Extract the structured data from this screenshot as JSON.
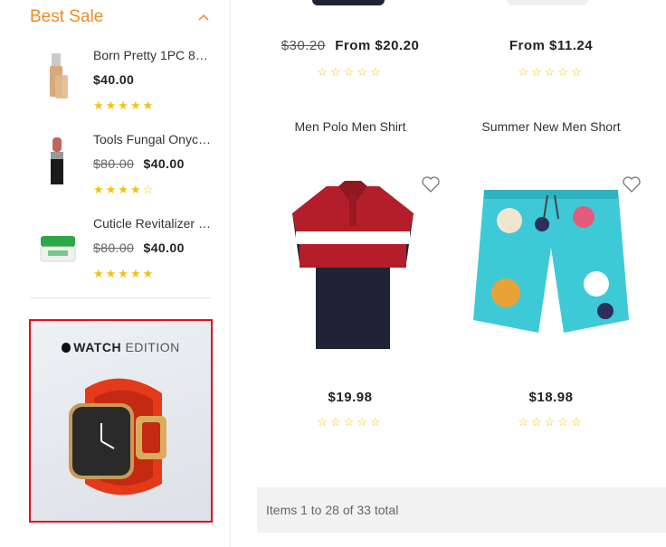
{
  "sidebar": {
    "best_sale_title": "Best Sale",
    "items": [
      {
        "name": "Born Pretty 1PC 8ml...",
        "old_price": "",
        "price": "$40.00",
        "stars": "★★★★★"
      },
      {
        "name": "Tools Fungal Onych...",
        "old_price": "$80.00",
        "price": "$40.00",
        "stars": "★★★★☆"
      },
      {
        "name": "Cuticle Revitalizer F...",
        "old_price": "$80.00",
        "price": "$40.00",
        "stars": "★★★★★"
      }
    ],
    "banner": {
      "brand": "WATCH",
      "edition": "EDITION"
    }
  },
  "products": [
    {
      "old_price": "$30.20",
      "price": "From $20.20",
      "stars": "☆☆☆☆☆"
    },
    {
      "old_price": "",
      "price": "From $11.24",
      "stars": "☆☆☆☆☆"
    },
    {
      "title": "Men Polo Men Shirt",
      "price": "$19.98",
      "stars": "☆☆☆☆☆"
    },
    {
      "title": "Summer New Men Short",
      "price": "$18.98",
      "stars": "☆☆☆☆☆"
    }
  ],
  "toolbar": {
    "total_text": "Items 1 to 28 of 33 total"
  },
  "colors": {
    "accent": "#f08a24",
    "star": "#f4c20d",
    "banner_border": "#e0101a"
  }
}
